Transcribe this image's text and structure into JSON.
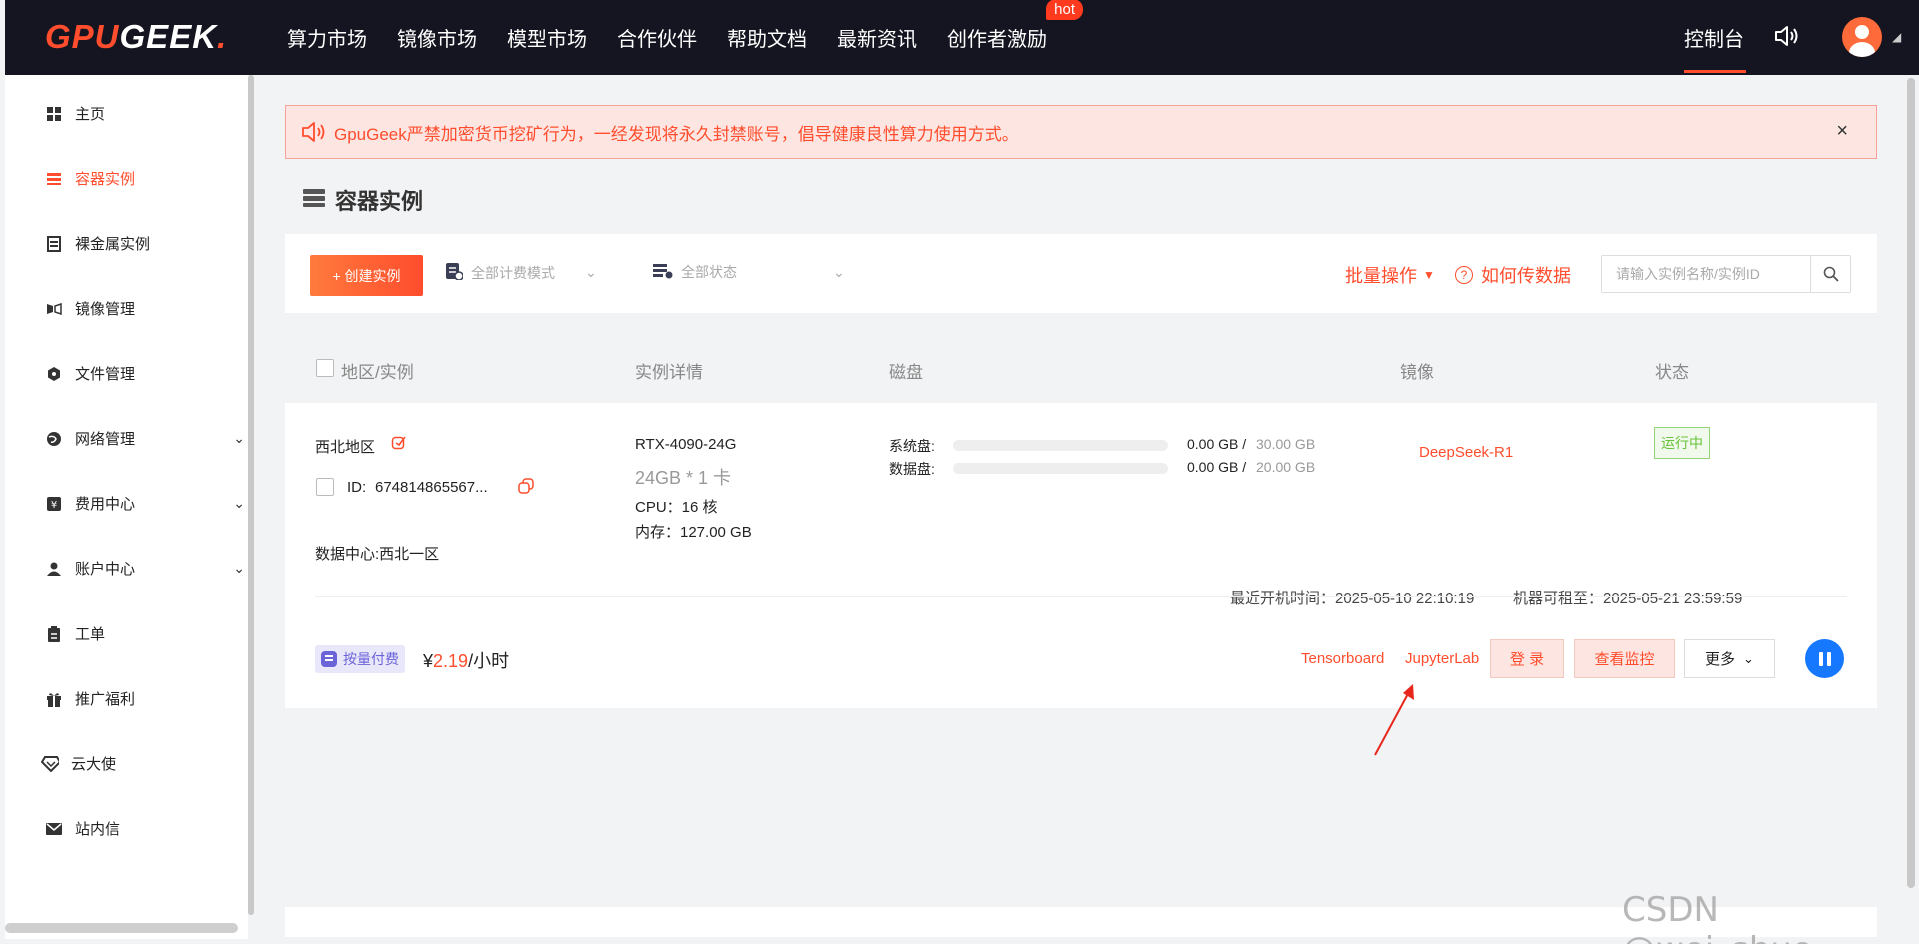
{
  "logo": {
    "part1": "GPU",
    "part2": "GEEK",
    "dot": "."
  },
  "nav": {
    "items": [
      "算力市场",
      "镜像市场",
      "模型市场",
      "合作伙伴",
      "帮助文档",
      "最新资讯",
      "创作者激励"
    ],
    "hot_badge": "hot",
    "console": "控制台"
  },
  "sidebar": {
    "items": [
      {
        "label": "主页",
        "icon": "grid-icon"
      },
      {
        "label": "容器实例",
        "icon": "list-icon",
        "active": true
      },
      {
        "label": "裸金属实例",
        "icon": "server-icon"
      },
      {
        "label": "镜像管理",
        "icon": "mirror-icon"
      },
      {
        "label": "文件管理",
        "icon": "cube-icon"
      },
      {
        "label": "网络管理",
        "icon": "globe-icon",
        "expandable": true
      },
      {
        "label": "费用中心",
        "icon": "yen-icon",
        "expandable": true
      },
      {
        "label": "账户中心",
        "icon": "user-icon",
        "expandable": true
      },
      {
        "label": "工单",
        "icon": "clipboard-icon"
      },
      {
        "label": "推广福利",
        "icon": "gift-icon"
      },
      {
        "label": "云大使",
        "icon": "diamond-icon"
      },
      {
        "label": "站内信",
        "icon": "mail-icon"
      }
    ]
  },
  "notice": {
    "text": "GpuGeek严禁加密货币挖矿行为，一经发现将永久封禁账号，倡导健康良性算力使用方式。",
    "close": "×"
  },
  "page": {
    "title": "容器实例"
  },
  "toolbar": {
    "create_label": "+ 创建实例",
    "billing_filter": "全部计费模式",
    "status_filter": "全部状态",
    "batch_label": "批量操作",
    "howto_label": "如何传数据",
    "search_placeholder": "请输入实例名称/实例ID"
  },
  "table": {
    "headers": {
      "region": "地区/实例",
      "detail": "实例详情",
      "disk": "磁盘",
      "image": "镜像",
      "status": "状态"
    }
  },
  "instance": {
    "region": "西北地区",
    "id_label": "ID:",
    "id": "674814865567...",
    "datacenter": "数据中心:西北一区",
    "gpu": "RTX-4090-24G",
    "gpu_mem": "24GB * 1 卡",
    "cpu": "CPU：16 核",
    "memory": "内存：127.00 GB",
    "sys_disk_label": "系统盘:",
    "sys_disk_used": "0.00 GB /",
    "sys_disk_total": "30.00 GB",
    "sys_disk_fraction": 0,
    "data_disk_label": "数据盘:",
    "data_disk_used": "0.00 GB /",
    "data_disk_total": "20.00 GB",
    "data_disk_fraction": 0,
    "image": "DeepSeek-R1",
    "status": "运行中",
    "last_boot": "最近开机时间：2025-05-10 22:10:19",
    "rent_until": "机器可租至：2025-05-21 23:59:59",
    "pay_mode": "按量付费",
    "price_currency": "¥",
    "price_value": "2.19",
    "price_unit": "/小时",
    "actions": {
      "tensorboard": "Tensorboard",
      "jupyterlab": "JupyterLab",
      "login": "登 录",
      "monitor": "查看监控",
      "more": "更多"
    }
  },
  "watermark": "CSDN @wei_shuo",
  "colors": {
    "accent": "#ff4d2d",
    "topbar": "#141520",
    "running": "#67c23a",
    "pay_badge": "#6b63d8",
    "pause": "#1677ff"
  }
}
